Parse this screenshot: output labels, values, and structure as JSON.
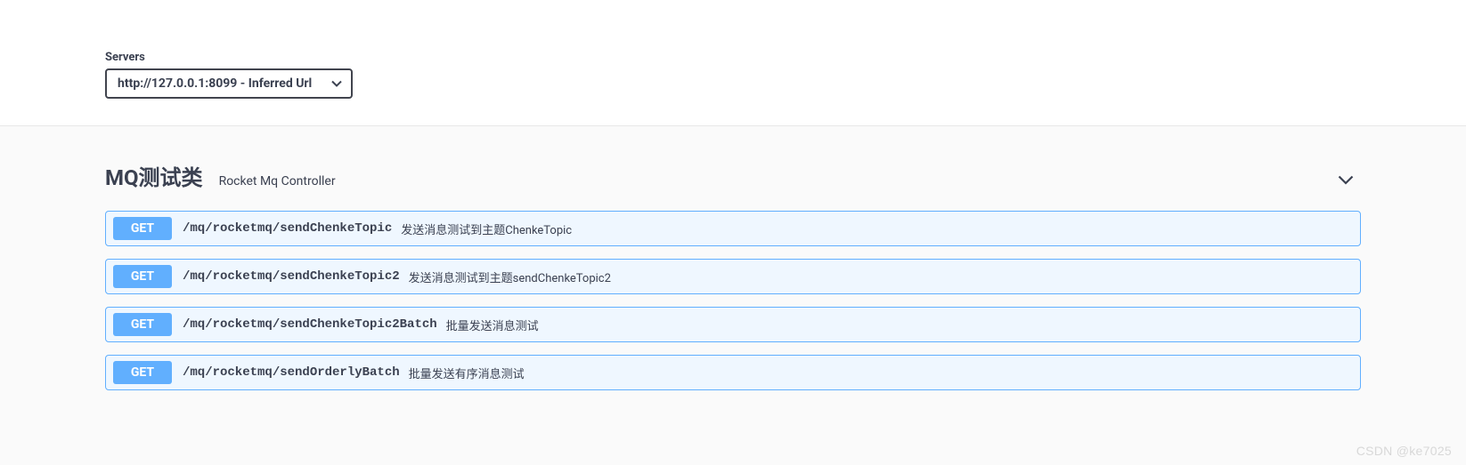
{
  "servers": {
    "label": "Servers",
    "selected": "http://127.0.0.1:8099 - Inferred Url"
  },
  "tag": {
    "title": "MQ测试类",
    "subtitle": "Rocket Mq Controller"
  },
  "operations": [
    {
      "method": "GET",
      "path": "/mq/rocketmq/sendChenkeTopic",
      "summary": "发送消息测试到主题ChenkeTopic"
    },
    {
      "method": "GET",
      "path": "/mq/rocketmq/sendChenkeTopic2",
      "summary": "发送消息测试到主题sendChenkeTopic2"
    },
    {
      "method": "GET",
      "path": "/mq/rocketmq/sendChenkeTopic2Batch",
      "summary": "批量发送消息测试"
    },
    {
      "method": "GET",
      "path": "/mq/rocketmq/sendOrderlyBatch",
      "summary": "批量发送有序消息测试"
    }
  ],
  "watermark": "CSDN @ke7025"
}
